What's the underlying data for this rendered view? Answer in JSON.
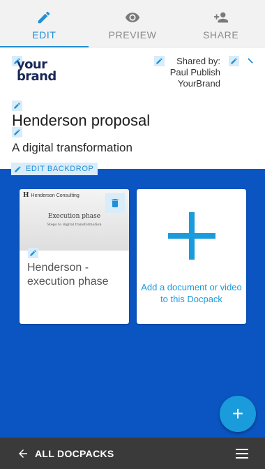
{
  "tabs": [
    {
      "label": "EDIT",
      "icon": "pencil-icon",
      "active": true
    },
    {
      "label": "PREVIEW",
      "icon": "eye-icon",
      "active": false
    },
    {
      "label": "SHARE",
      "icon": "add-person-icon",
      "active": false
    }
  ],
  "header": {
    "logo": {
      "line1": "your",
      "line2": "brand"
    },
    "shared_by": {
      "label": "Shared by:",
      "name": "Paul Publish",
      "company": "YourBrand"
    },
    "title": "Henderson proposal",
    "subtitle": "A digital transformation",
    "edit_backdrop_label": "EDIT BACKDROP"
  },
  "documents": [
    {
      "name": "Henderson - execution phase",
      "thumbnail": {
        "brand_small": "Henderson Consulting",
        "slide_title": "Execution phase",
        "slide_subtitle": "Steps to digital transformation"
      }
    }
  ],
  "add_card": {
    "label": "Add a document or video to this Docpack"
  },
  "fab": {
    "label": "+"
  },
  "bottom_bar": {
    "back_label": "ALL DOCPACKS"
  },
  "colors": {
    "accent": "#1f8fd6",
    "backdrop": "#0a55c2",
    "bottom_bar": "#3a3a3a",
    "chip": "#d8ecfa"
  }
}
